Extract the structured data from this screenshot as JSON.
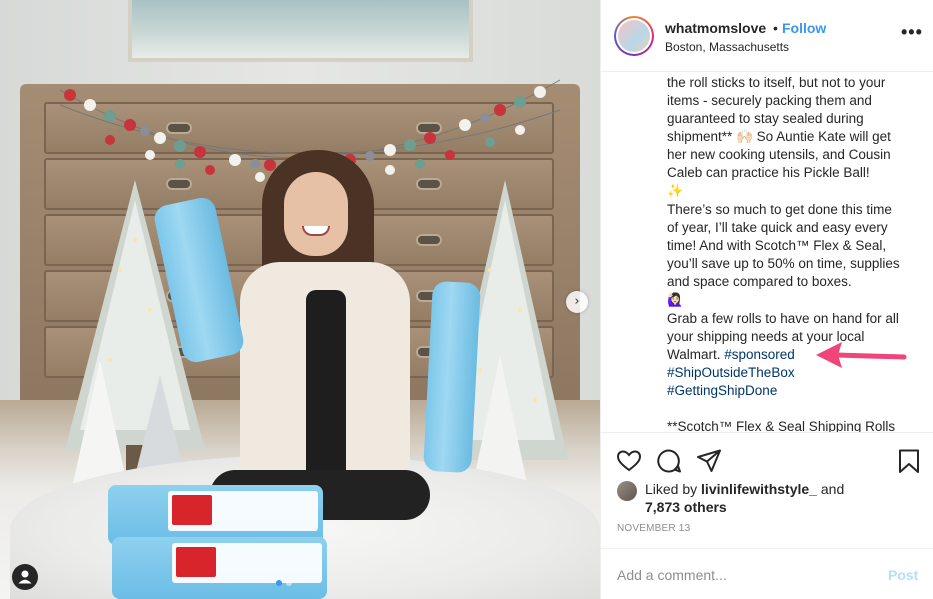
{
  "post": {
    "username": "whatmomslove",
    "separator": "•",
    "follow_label": "Follow",
    "location": "Boston, Massachusetts",
    "more_label": "•••"
  },
  "caption": {
    "lines": [
      {
        "text": "the roll sticks to itself, but not to your"
      },
      {
        "text": "items - securely packing them and"
      },
      {
        "text": "guaranteed to stay sealed during"
      },
      {
        "text": "shipment** 🙌🏻 So Auntie Kate will get"
      },
      {
        "text": "her new cooking utensils, and Cousin"
      },
      {
        "text": "Caleb can practice his Pickle Ball!"
      },
      {
        "text": "✨"
      },
      {
        "text": "There’s so much to get done this time"
      },
      {
        "text": "of year, I’ll take quick and easy every"
      },
      {
        "text": "time! And with Scotch™ Flex & Seal,"
      },
      {
        "text": "you’ll save up to 50% on time, supplies"
      },
      {
        "text": "and space compared to boxes."
      },
      {
        "text": "🙋🏻‍♀️"
      },
      {
        "text": "Grab a few rolls to have on hand for all"
      },
      {
        "text": "your shipping needs at your local"
      },
      {
        "text": "Walmart. "
      },
      {
        "text": "#ShipOutsideTheBox"
      },
      {
        "text": "#GettingShipDone"
      },
      {
        "text": ""
      },
      {
        "text": "**Scotch™ Flex & Seal Shipping Rolls"
      }
    ],
    "hashtag_sponsored": "#sponsored",
    "hashtag_ship": "#ShipOutsideTheBox",
    "hashtag_getting": "#GettingShipDone"
  },
  "actions": {
    "like_icon": "heart-icon",
    "comment_icon": "comment-icon",
    "share_icon": "share-icon",
    "save_icon": "bookmark-icon"
  },
  "likes": {
    "prefix": "Liked by ",
    "user": "livinlifewithstyle_",
    "conj": " and",
    "count": "7,873 others"
  },
  "date": "NOVEMBER 13",
  "comment": {
    "placeholder": "Add a comment...",
    "post_label": "Post"
  },
  "colors": {
    "link_blue": "#3897f0",
    "hashtag": "#003569",
    "arrow": "#f0457a",
    "post_disabled": "#b2dffc"
  },
  "carousel": {
    "next_label": "›",
    "index": 1,
    "total": 1
  }
}
